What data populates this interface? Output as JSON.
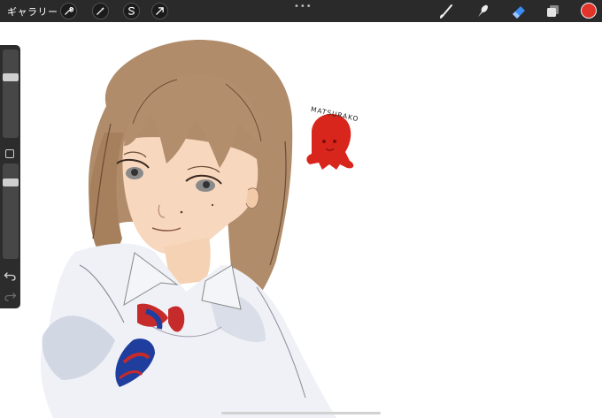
{
  "toolbar": {
    "gallery_label": "ギャラリー",
    "left_tools": [
      "wrench-icon",
      "magic-wand-icon",
      "selection-icon",
      "transform-arrow-icon"
    ],
    "more_label": "•••",
    "right_tools": [
      "brush-icon",
      "smudge-icon",
      "eraser-icon",
      "layers-icon"
    ],
    "active_color": "#e3342a"
  },
  "sidebar": {
    "brush_size": 0.3,
    "opacity": 0.17
  },
  "artwork": {
    "mascot_label": "MATSURAKO"
  }
}
